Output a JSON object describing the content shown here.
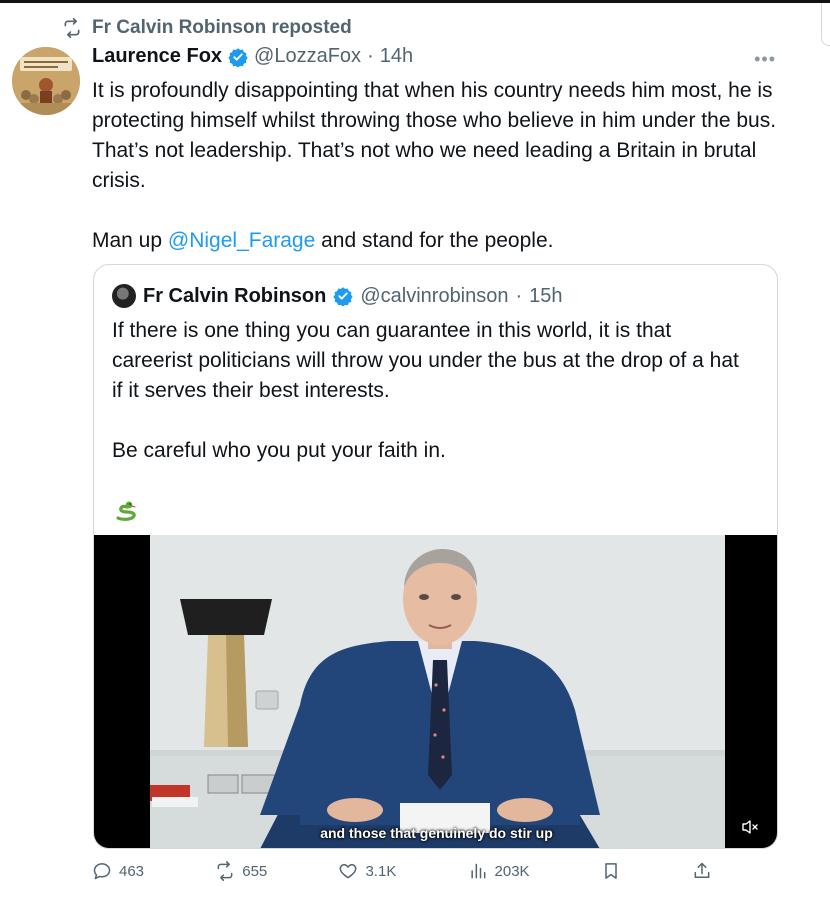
{
  "repost": {
    "text": "Fr Calvin Robinson reposted"
  },
  "tweet": {
    "author_name": "Laurence Fox",
    "handle": "@LozzaFox",
    "time": "14h",
    "paragraph1": "It is profoundly disappointing that when his country needs him most, he is protecting himself whilst throwing those who believe in him under the bus. That’s not leadership. That’s not who we need leading a Britain in brutal crisis.",
    "p2_prefix": "Man up ",
    "p2_mention": "@Nigel_Farage",
    "p2_suffix": " and stand for the people."
  },
  "quote": {
    "author_name": "Fr Calvin Robinson",
    "handle": "@calvinrobinson",
    "time": "15h",
    "paragraph1": "If there is one thing you can guarantee in this world, it is that careerist politicians will throw you under the bus at the drop of a hat if it serves their best interests.",
    "paragraph2": "Be careful who you put your faith in.",
    "emoji_icon": "snake-icon",
    "video_caption": "and those that genuinely do stir up"
  },
  "actions": {
    "replies": "463",
    "reposts": "655",
    "likes": "3.1K",
    "views": "203K"
  },
  "colors": {
    "link": "#1d9bf0",
    "verified": "#1d9bf0",
    "muted_text": "#536471"
  }
}
